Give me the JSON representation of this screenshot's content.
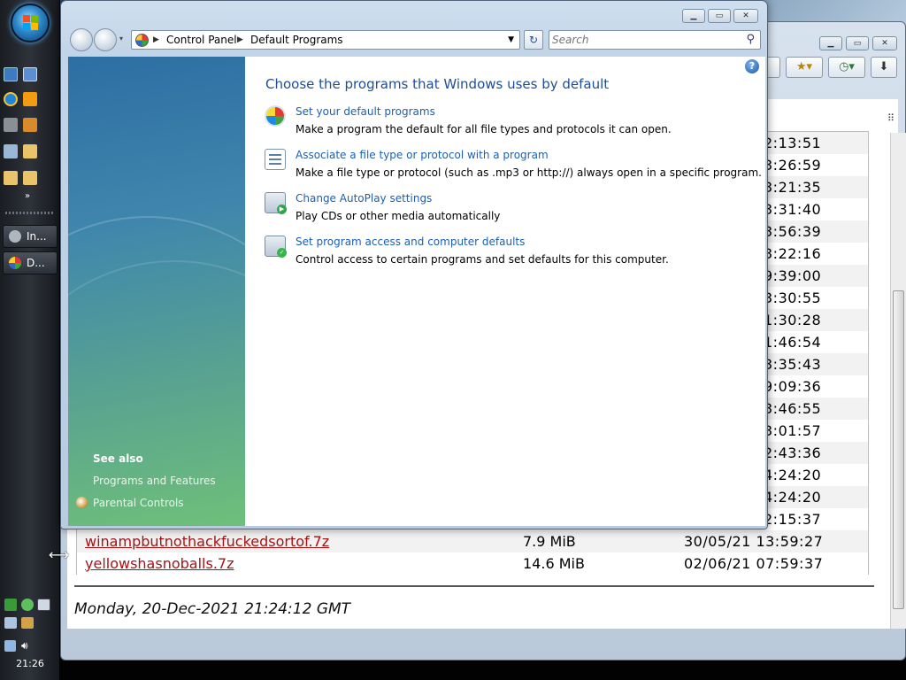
{
  "taskbar": {
    "buttons": [
      {
        "label": "In..."
      },
      {
        "label": "D..."
      }
    ],
    "clock": "21:26"
  },
  "background_window": {
    "files": [
      {
        "name": "winampbutnothackfuckedsortof.7z",
        "size": "7.9 MiB",
        "date": "30/05/21 13:59:27"
      },
      {
        "name": "yellowshasnoballs.7z",
        "size": "14.6 MiB",
        "date": "02/06/21 07:59:37"
      }
    ],
    "partial_times": [
      "2:13:51",
      "3:26:59",
      "3:21:35",
      "3:31:40",
      "3:56:39",
      "3:22:16",
      "9:39:00",
      "3:30:55",
      "1:30:28",
      "1:46:54",
      "3:35:43",
      "9:09:36",
      "3:46:55",
      "3:01:57",
      "2:43:36",
      "4:24:20",
      "4:24:20",
      "2:15:37"
    ],
    "footer": "Monday, 20-Dec-2021 21:24:12 GMT"
  },
  "control_panel": {
    "breadcrumb": [
      "Control Panel",
      "Default Programs"
    ],
    "search_placeholder": "Search",
    "heading": "Choose the programs that Windows uses by default",
    "tasks": [
      {
        "link": "Set your default programs",
        "desc": "Make a program the default for all file types and protocols it can open.",
        "icon": "default-programs-icon"
      },
      {
        "link": "Associate a file type or protocol with a program",
        "desc": "Make a file type or protocol (such as .mp3 or http://) always open in a specific program.",
        "icon": "file-association-icon"
      },
      {
        "link": "Change AutoPlay settings",
        "desc": "Play CDs or other media automatically",
        "icon": "autoplay-icon"
      },
      {
        "link": "Set program access and computer defaults",
        "desc": "Control access to certain programs and set defaults for this computer.",
        "icon": "program-access-icon"
      }
    ],
    "see_also": {
      "title": "See also",
      "links": [
        "Programs and Features",
        "Parental Controls"
      ]
    }
  }
}
